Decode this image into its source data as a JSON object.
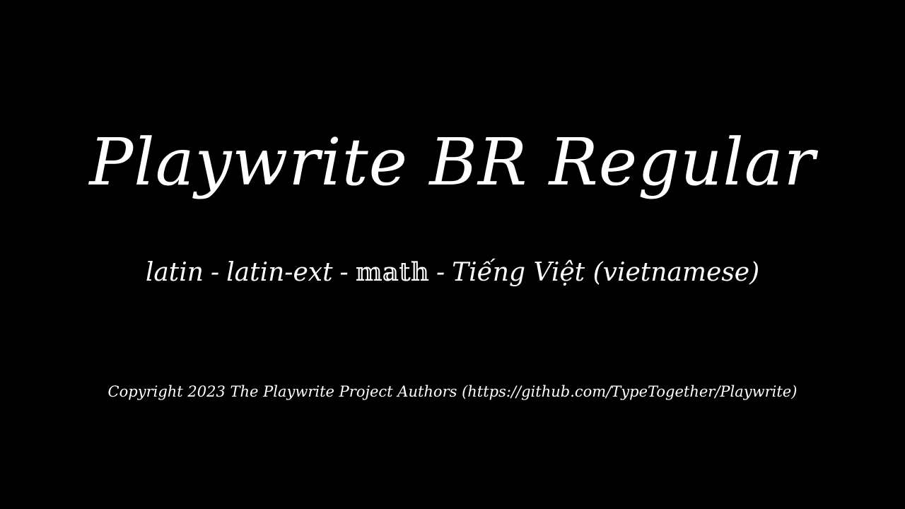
{
  "specimen": {
    "title": "Playwrite BR Regular",
    "subsets": {
      "items": [
        "latin",
        "latin-ext",
        "𝕞𝕒𝕥𝕙",
        "Tiếng Việt (vietnamese)"
      ],
      "separator": "-"
    },
    "copyright": "Copyright 2023 The Playwrite Project Authors (https://github.com/TypeTogether/Playwrite)"
  },
  "colors": {
    "background": "#000000",
    "text": "#ffffff"
  }
}
